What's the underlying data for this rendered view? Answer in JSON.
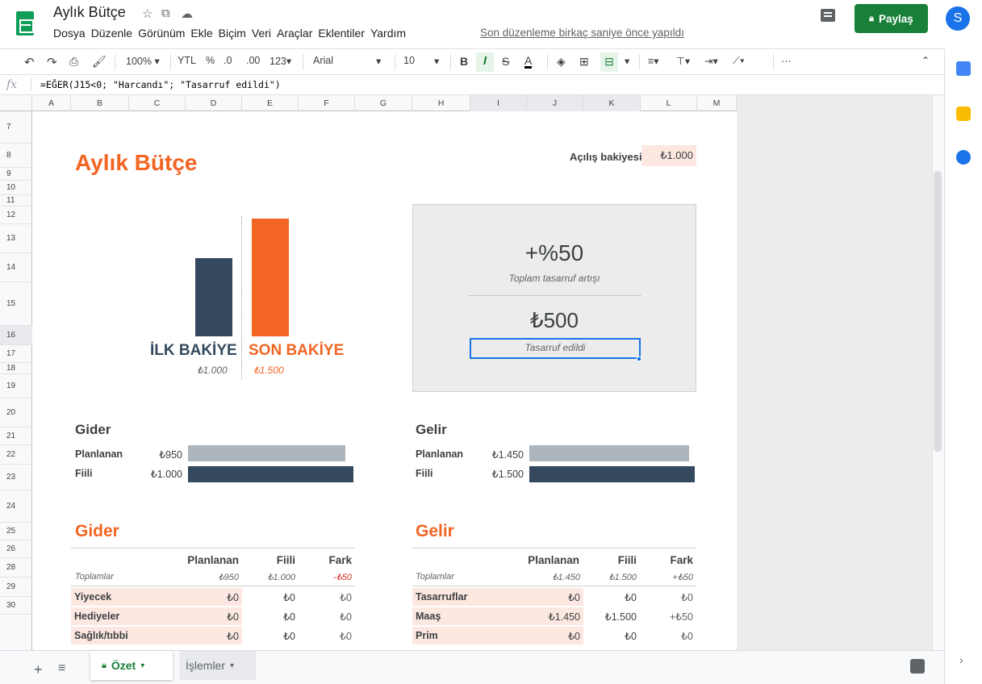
{
  "header": {
    "doc_title": "Aylık Bütçe",
    "menu": [
      "Dosya",
      "Düzenle",
      "Görünüm",
      "Ekle",
      "Biçim",
      "Veri",
      "Araçlar",
      "Eklentiler",
      "Yardım"
    ],
    "last_edit": "Son düzenleme birkaç saniye önce yapıldı",
    "share_label": "Paylaş",
    "avatar_initial": "S"
  },
  "toolbar": {
    "zoom": "100%",
    "currency": "YTL",
    "percent": "%",
    "dec_decrease": ".0",
    "dec_increase": ".00",
    "number_format": "123",
    "font": "Arial",
    "font_size": "10",
    "bold": "B",
    "italic": "I",
    "strike": "S",
    "text_color": "A",
    "more": "⋯"
  },
  "formula": {
    "fx": "fx",
    "text": "=EĞER(J15<0; \"Harcandı\"; \"Tasarruf edildi\")"
  },
  "columns": [
    "A",
    "B",
    "C",
    "D",
    "E",
    "F",
    "G",
    "H",
    "I",
    "J",
    "K",
    "L",
    "M"
  ],
  "rows": [
    "7",
    "8",
    "9",
    "10",
    "11",
    "12",
    "13",
    "14",
    "15",
    "16",
    "17",
    "18",
    "19",
    "20",
    "21",
    "22",
    "23",
    "24",
    "25",
    "26",
    "28",
    "29",
    "30"
  ],
  "sheet": {
    "title": "Aylık Bütçe",
    "opening_label": "Açılış bakiyesi:",
    "opening_value": "₺1.000",
    "initial_label": "İLK BAKİYE",
    "final_label": "SON BAKİYE",
    "initial_value": "₺1.000",
    "final_value": "₺1.500",
    "pct_value": "+%50",
    "pct_label": "Toplam tasarruf artışı",
    "saved_value": "₺500",
    "saved_label": "Tasarruf edildi"
  },
  "chart_data": {
    "type": "bar",
    "categories": [
      "İLK BAKİYE",
      "SON BAKİYE"
    ],
    "values": [
      1000,
      1500
    ],
    "ylim": [
      0,
      1500
    ]
  },
  "expense_summary": {
    "title": "Gider",
    "planned_label": "Planlanan",
    "actual_label": "Fiili",
    "planned_value": "₺950",
    "actual_value": "₺1.000",
    "planned_fraction": 0.95,
    "actual_fraction": 1.0
  },
  "income_summary": {
    "title": "Gelir",
    "planned_label": "Planlanan",
    "actual_label": "Fiili",
    "planned_value": "₺1.450",
    "actual_value": "₺1.500",
    "planned_fraction": 0.967,
    "actual_fraction": 1.0
  },
  "expense_table": {
    "title": "Gider",
    "headers": [
      "Planlanan",
      "Fiili",
      "Fark"
    ],
    "totals_label": "Toplamlar",
    "totals": [
      "₺950",
      "₺1.000",
      "-₺50"
    ],
    "rows": [
      {
        "name": "Yiyecek",
        "planned": "₺0",
        "actual": "₺0",
        "diff": "₺0"
      },
      {
        "name": "Hediyeler",
        "planned": "₺0",
        "actual": "₺0",
        "diff": "₺0"
      },
      {
        "name": "Sağlık/tıbbi",
        "planned": "₺0",
        "actual": "₺0",
        "diff": "₺0"
      }
    ]
  },
  "income_table": {
    "title": "Gelir",
    "headers": [
      "Planlanan",
      "Fiili",
      "Fark"
    ],
    "totals_label": "Toplamlar",
    "totals": [
      "₺1.450",
      "₺1.500",
      "+₺50"
    ],
    "rows": [
      {
        "name": "Tasarruflar",
        "planned": "₺0",
        "actual": "₺0",
        "diff": "₺0"
      },
      {
        "name": "Maaş",
        "planned": "₺1.450",
        "actual": "₺1.500",
        "diff": "+₺50"
      },
      {
        "name": "Prim",
        "planned": "₺0",
        "actual": "₺0",
        "diff": "₺0"
      }
    ]
  },
  "tabs": {
    "active": "Özet",
    "other": "İşlemler"
  },
  "colors": {
    "accent": "#f26522",
    "navy": "#34495e",
    "planned_bar": "#adb5bd",
    "share_green": "#188038",
    "selection_blue": "#1a73e8"
  }
}
